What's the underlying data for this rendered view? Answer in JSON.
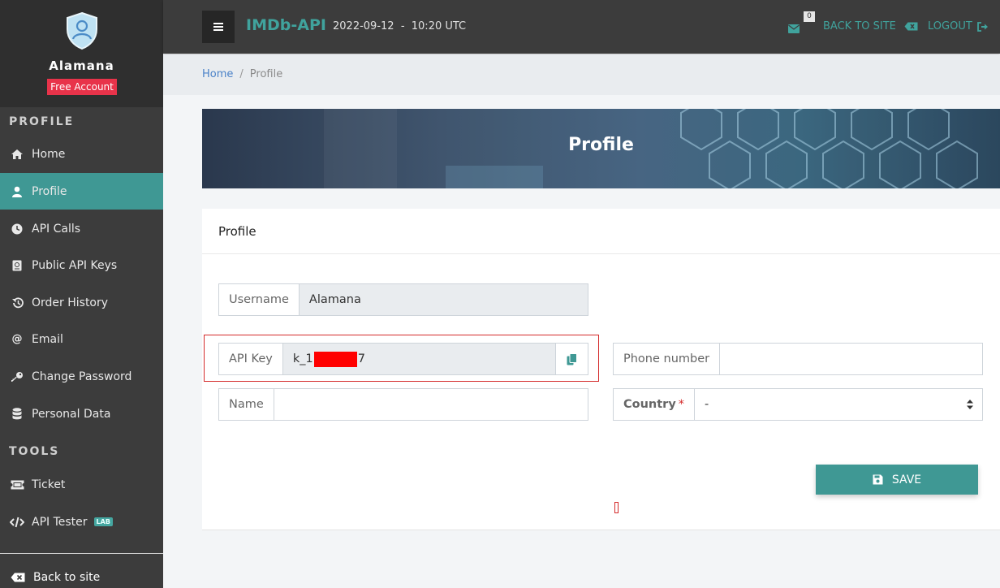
{
  "sidebar": {
    "username": "Alamana",
    "badge": "Free Account",
    "section_profile": "PROFILE",
    "section_tools": "TOOLS",
    "items": [
      {
        "label": "Home",
        "icon": "home-icon"
      },
      {
        "label": "Profile",
        "icon": "user-icon",
        "active": true
      },
      {
        "label": "API Calls",
        "icon": "clock-icon"
      },
      {
        "label": "Public API Keys",
        "icon": "passport-icon"
      },
      {
        "label": "Order History",
        "icon": "history-icon"
      },
      {
        "label": "Email",
        "icon": "at-icon"
      },
      {
        "label": "Change Password",
        "icon": "key-icon"
      },
      {
        "label": "Personal Data",
        "icon": "database-icon"
      }
    ],
    "tools": [
      {
        "label": "Ticket",
        "icon": "ticket-icon"
      },
      {
        "label": "API Tester",
        "icon": "code-icon",
        "badge": "LAB"
      }
    ],
    "back_label": "Back to site"
  },
  "topbar": {
    "brand": "IMDb-API",
    "datetime": "2022-09-12  -  10:20 UTC",
    "mail_count": "0",
    "back_to_site": "BACK TO SITE",
    "logout": "LOGOUT"
  },
  "breadcrumb": {
    "home": "Home",
    "sep": "/",
    "current": "Profile"
  },
  "banner": {
    "title": "Profile"
  },
  "card": {
    "title": "Profile",
    "username_label": "Username",
    "username_value": "Alamana",
    "apikey_label": "API Key",
    "apikey_prefix": "k_1",
    "apikey_suffix": "7",
    "phone_label": "Phone number",
    "phone_value": "",
    "name_label": "Name",
    "name_value": "",
    "country_label": "Country",
    "country_required": "*",
    "country_value": "-",
    "save_label": "SAVE"
  },
  "colors": {
    "accent": "#3f9894",
    "brand": "#40a39d",
    "badge": "#e8334a",
    "sidebar": "#3c3c3c"
  }
}
